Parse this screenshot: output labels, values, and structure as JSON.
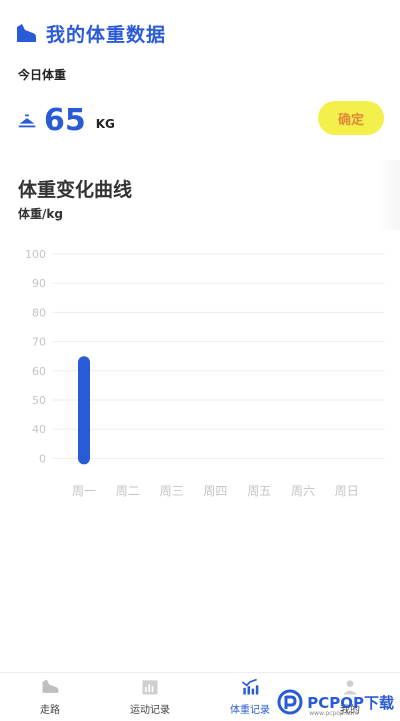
{
  "header": {
    "title": "我的体重数据",
    "icon": "shoe-icon"
  },
  "today": {
    "label": "今日体重",
    "value": "65",
    "unit": "KG",
    "confirm_label": "确定"
  },
  "chart_section": {
    "title": "体重变化曲线",
    "unit_label": "体重/kg"
  },
  "chart_data": {
    "type": "bar",
    "categories": [
      "周一",
      "周二",
      "周三",
      "周四",
      "周五",
      "周六",
      "周日"
    ],
    "values": [
      65,
      0,
      0,
      0,
      0,
      0,
      0
    ],
    "y_ticks": [
      "100",
      "90",
      "80",
      "70",
      "60",
      "50",
      "40",
      "0"
    ],
    "ylabel": "体重/kg",
    "grid": true,
    "bar_color": "#2a5bd7"
  },
  "tabbar": {
    "items": [
      {
        "label": "走路",
        "icon": "shoe-icon"
      },
      {
        "label": "运动记录",
        "icon": "bar-chart-icon"
      },
      {
        "label": "体重记录",
        "icon": "weight-chart-icon",
        "active": true
      },
      {
        "label": "我的",
        "icon": "user-icon"
      }
    ]
  },
  "watermark": {
    "text": "PCPOP下载",
    "sub": "www.pcpop.com"
  },
  "colors": {
    "accent": "#2a5bd7",
    "button_bg": "#f3ef4b",
    "button_text": "#e08a3a"
  }
}
